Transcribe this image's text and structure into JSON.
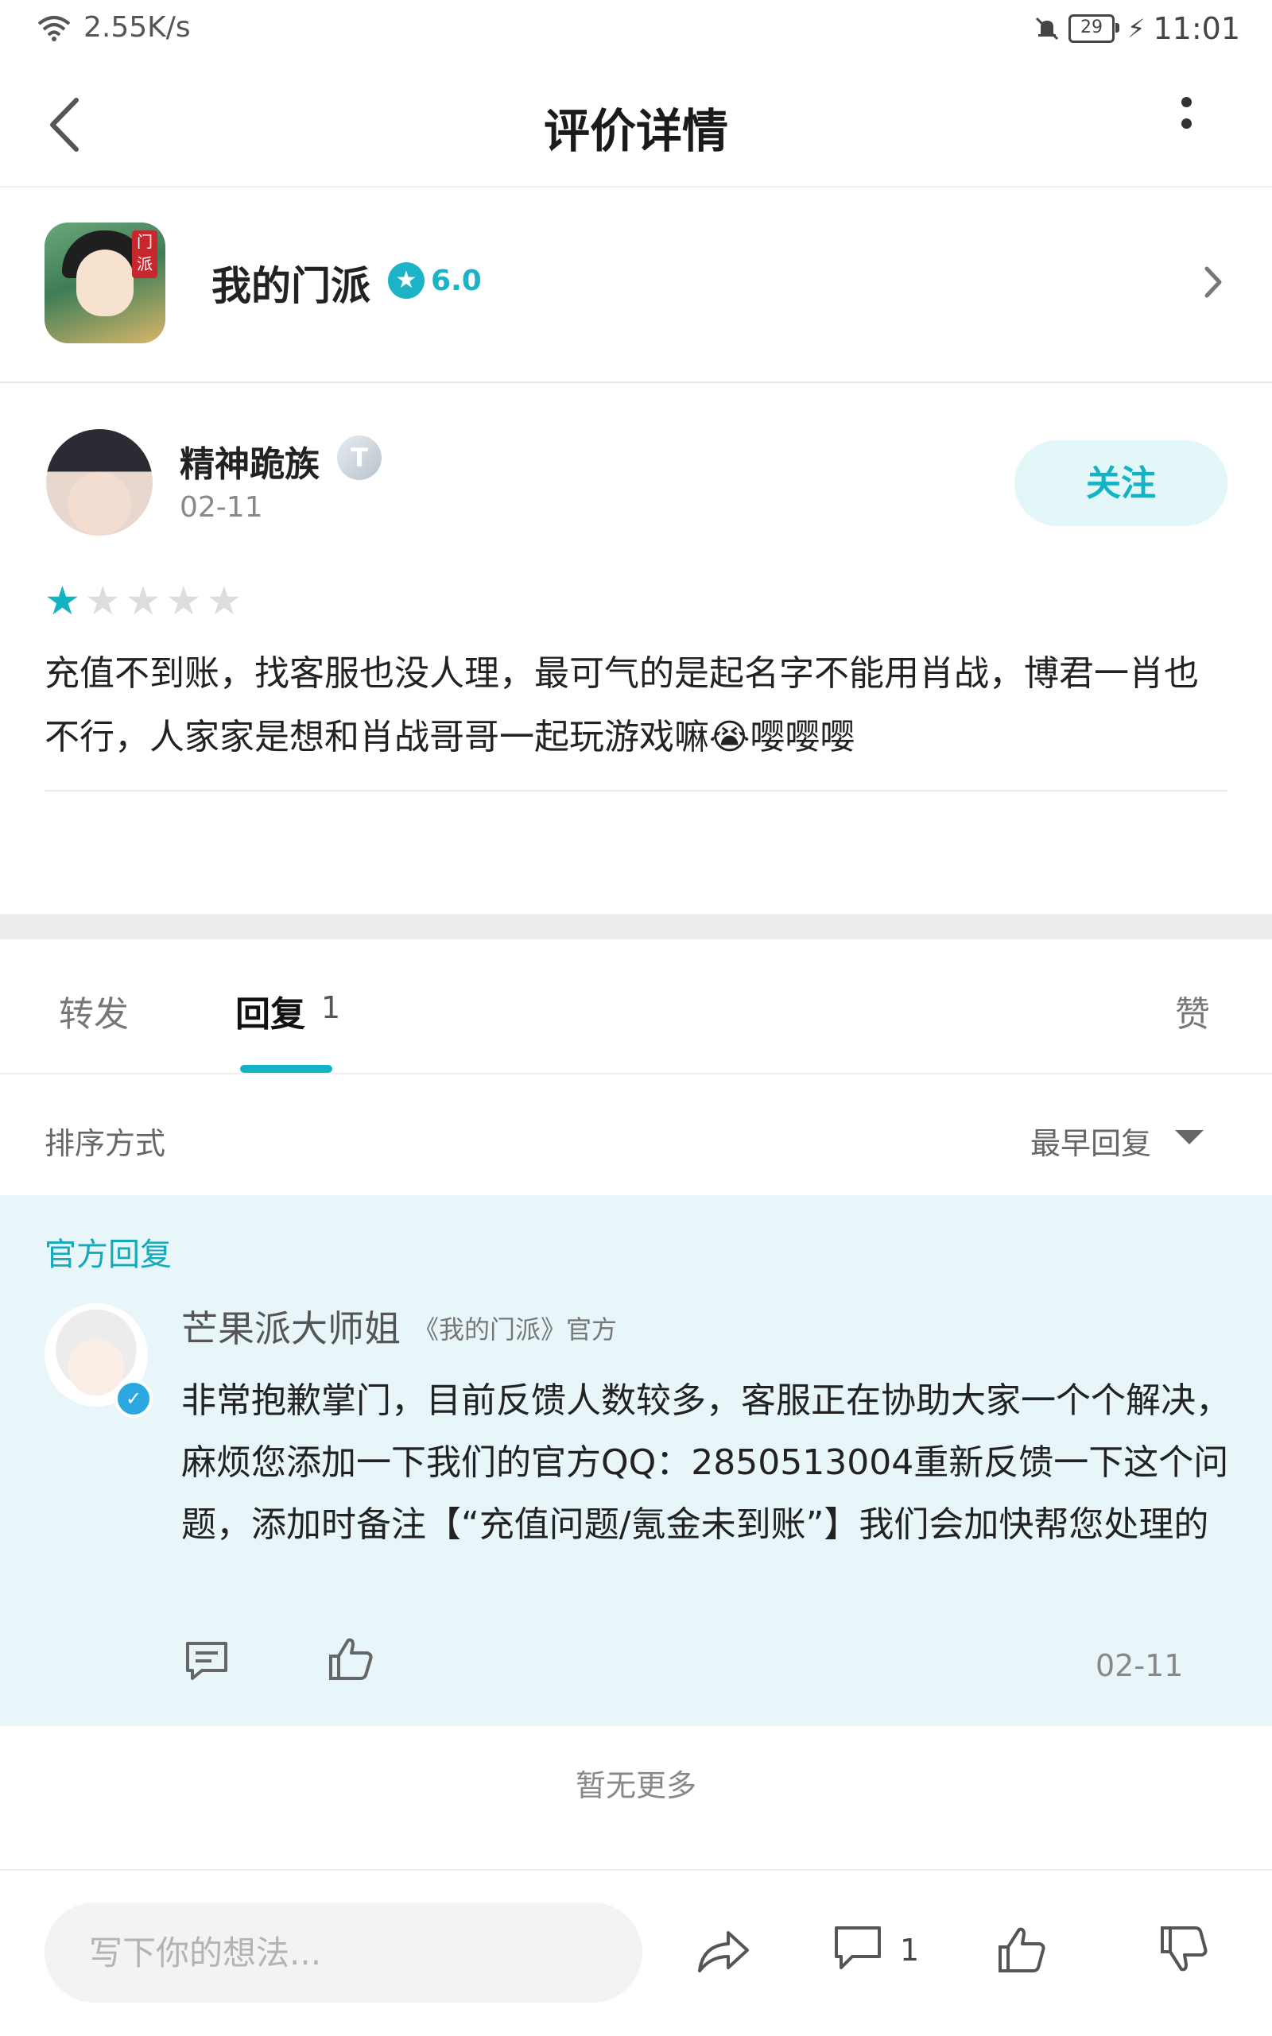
{
  "status_bar": {
    "net_speed": "2.55K/s",
    "battery": "29",
    "time": "11:01"
  },
  "header": {
    "title": "评价详情"
  },
  "app": {
    "name": "我的门派",
    "rating": "6.0",
    "icon_tag": "门派"
  },
  "review": {
    "user_name": "精神跪族",
    "level_badge": "T",
    "date": "02-11",
    "follow_label": "关注",
    "stars_filled": 1,
    "stars_total": 5,
    "text": "充值不到账，找客服也没人理，最可气的是起名字不能用肖战，博君一肖也不行，人家家是想和肖战哥哥一起玩游戏嘛😭嘤嘤嘤"
  },
  "tabs": {
    "repost": "转发",
    "reply": "回复",
    "reply_count": "1",
    "like": "赞"
  },
  "sort": {
    "label": "排序方式",
    "value": "最早回复"
  },
  "official_reply": {
    "section_label": "官方回复",
    "name": "芒果派大师姐",
    "tag": "《我的门派》官方",
    "text": "非常抱歉掌门，目前反馈人数较多，客服正在协助大家一个个解决，麻烦您添加一下我们的官方QQ：2850513004重新反馈一下这个问题，添加时备注【“充值问题/氪金未到账”】我们会加快帮您处理的",
    "date": "02-11"
  },
  "no_more": "暂无更多",
  "bottom_bar": {
    "input_placeholder": "写下你的想法...",
    "comment_count": "1"
  },
  "colors": {
    "accent": "#14b3c4",
    "official_bg": "#e8f6f9",
    "star_empty": "#dddddd"
  }
}
